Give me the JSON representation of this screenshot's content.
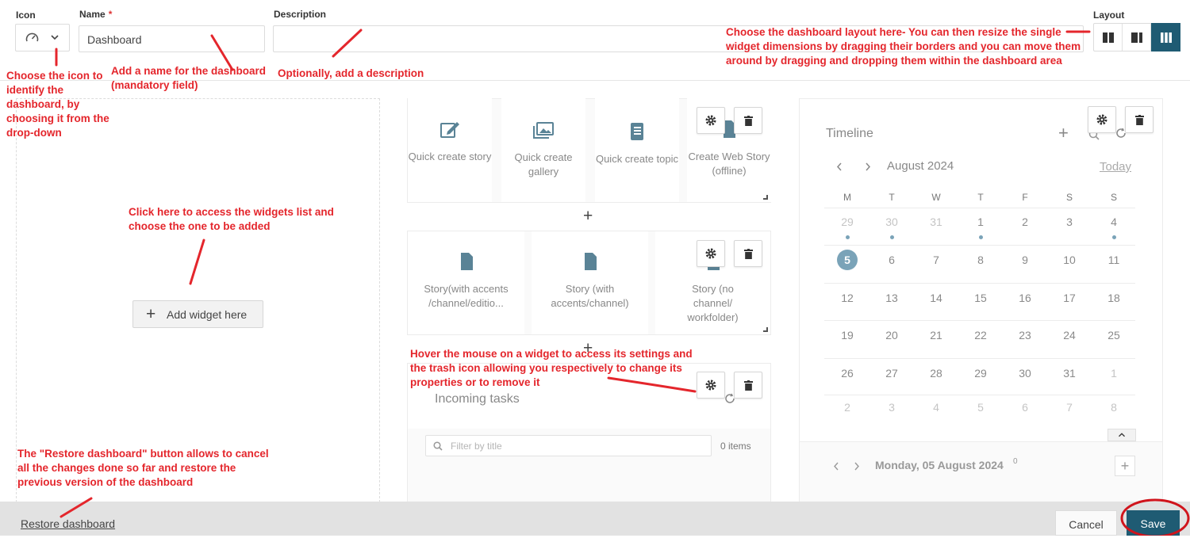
{
  "header": {
    "icon_label": "Icon",
    "name_label": "Name",
    "required_mark": "*",
    "name_value": "Dashboard",
    "description_label": "Description",
    "description_value": "",
    "layout_label": "Layout"
  },
  "widgets": {
    "quick_create": [
      {
        "label": "Quick create story",
        "icon": "edit-icon"
      },
      {
        "label": "Quick create gallery",
        "icon": "gallery-icon"
      },
      {
        "label": "Quick create topic",
        "icon": "notebook-icon"
      },
      {
        "label": "Create Web Story (offline)",
        "icon": "document-icon"
      }
    ],
    "story_templates": [
      {
        "label": "Story(with accents /channel/editio...",
        "icon": "document-icon"
      },
      {
        "label": "Story (with accents/channel)",
        "icon": "document-icon"
      },
      {
        "label": "Story (no channel/ workfolder)",
        "icon": "document-icon"
      }
    ],
    "incoming_tasks": {
      "title": "Incoming tasks",
      "filter_placeholder": "Filter by title",
      "count": "0 items"
    },
    "add_symbol": "+",
    "add_widget_label": "Add widget here"
  },
  "timeline": {
    "title": "Timeline",
    "month": "August 2024",
    "today": "Today",
    "weekdays": [
      "M",
      "T",
      "W",
      "T",
      "F",
      "S",
      "S"
    ],
    "weeks": [
      [
        "29",
        "30",
        "31",
        "1",
        "2",
        "3",
        "4"
      ],
      [
        "5",
        "6",
        "7",
        "8",
        "9",
        "10",
        "11"
      ],
      [
        "12",
        "13",
        "14",
        "15",
        "16",
        "17",
        "18"
      ],
      [
        "19",
        "20",
        "21",
        "22",
        "23",
        "24",
        "25"
      ],
      [
        "26",
        "27",
        "28",
        "29",
        "30",
        "31",
        "1"
      ],
      [
        "2",
        "3",
        "4",
        "5",
        "6",
        "7",
        "8"
      ]
    ],
    "selected_date_label": "Monday, 05 August 2024",
    "event_count": "0"
  },
  "footer": {
    "restore": "Restore dashboard",
    "cancel": "Cancel",
    "save": "Save"
  },
  "annotations": {
    "icon": "Choose the icon to identify the dashboard, by choosing it from the drop-down",
    "name": "Add a name for the dashboard (mandatory field)",
    "description": "Optionally, add a description",
    "layout": "Choose the dashboard layout here- You can then resize the single widget dimensions by dragging their borders and you can move them around by dragging and dropping them within the dashboard area",
    "widgets": "Click here to access the widgets list and choose the one to be added",
    "hover": "Hover the mouse on a widget to access its settings and the trash icon allowing you respectively  to change its properties or to remove it",
    "restore": "The \"Restore dashboard\" button allows to cancel all the changes done so far and restore the previous version of the dashboard"
  },
  "colors": {
    "annotation": "#e4262c",
    "accent": "#1f5b73",
    "selected_day": "#7aa3b8"
  }
}
